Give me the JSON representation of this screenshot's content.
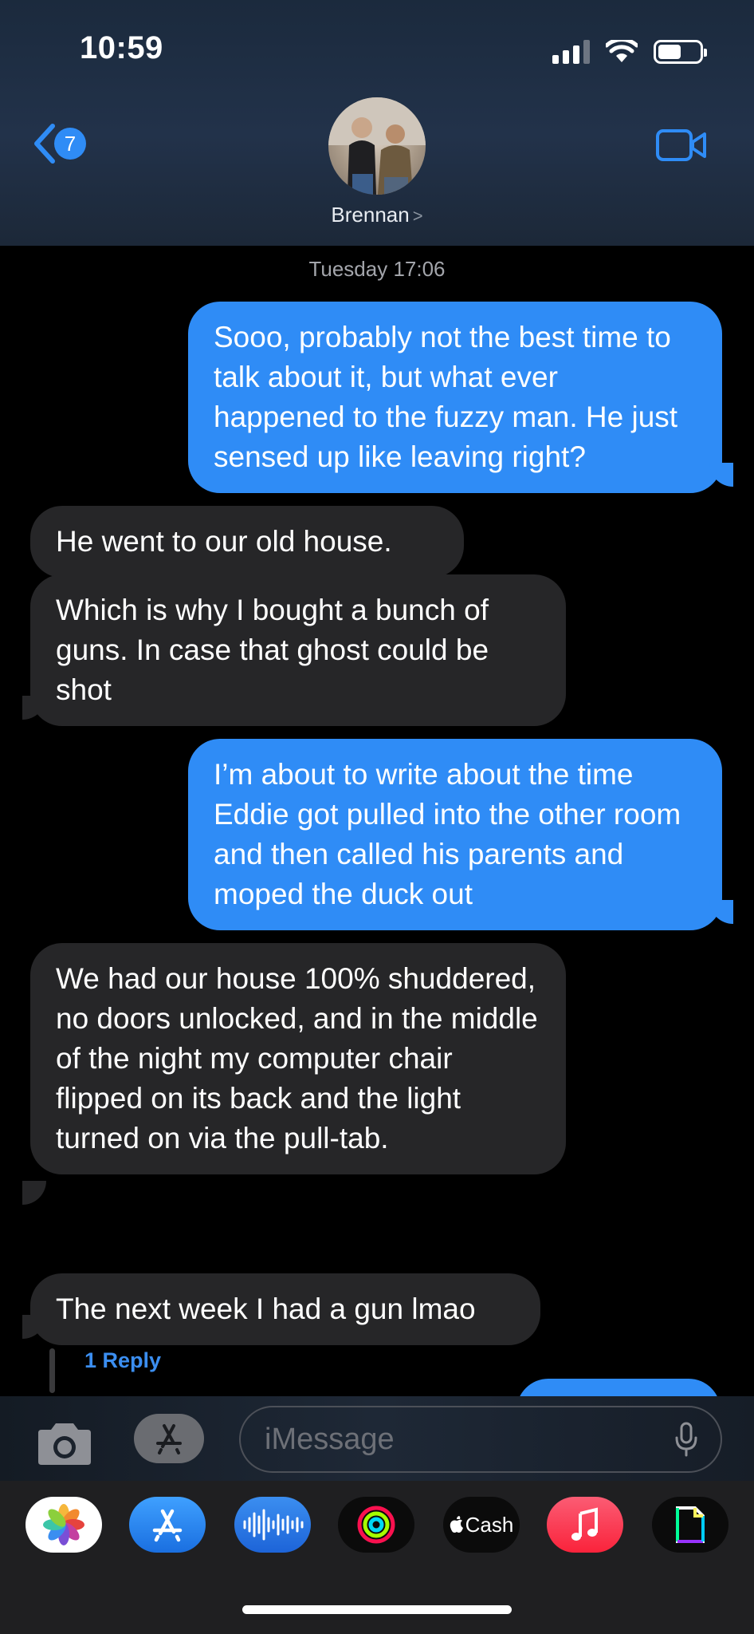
{
  "status": {
    "time": "10:59"
  },
  "header": {
    "back_badge": "7",
    "contact_name": "Brennan",
    "chevron": ">"
  },
  "conversation": {
    "timestamp": "Tuesday 17:06",
    "messages": [
      {
        "dir": "out",
        "text": "Sooo, probably not the best time to talk about it, but what ever happened to the fuzzy man. He just sensed up like leaving right?"
      },
      {
        "dir": "in",
        "text": "He went to our old house."
      },
      {
        "dir": "in",
        "text": "Which is why I bought a bunch of guns. In case that ghost could be shot"
      },
      {
        "dir": "out",
        "text": "I’m about to write about the time Eddie got pulled into the other room and then called his parents and moped the duck out"
      },
      {
        "dir": "in",
        "text": "We had our house 100% shuddered, no doors unlocked, and in the middle of the night my computer chair flipped on its back and the light turned on via the pull-tab."
      },
      {
        "dir": "in",
        "text": "The next week I had a gun lmao"
      }
    ],
    "reply_link": "1 Reply"
  },
  "composer": {
    "placeholder": "iMessage"
  },
  "app_tray": [
    {
      "name": "photos",
      "icon": "photos-icon"
    },
    {
      "name": "app-store",
      "icon": "app-store-icon"
    },
    {
      "name": "audio-message",
      "icon": "waveform-icon"
    },
    {
      "name": "activity",
      "icon": "activity-rings-icon"
    },
    {
      "name": "cash",
      "icon": "cash-icon",
      "label": "Cash"
    },
    {
      "name": "music",
      "icon": "music-note-icon"
    },
    {
      "name": "gif",
      "icon": "gif-icon"
    }
  ],
  "colors": {
    "outgoing_bubble": "#2f8cf6",
    "incoming_bubble": "#262628",
    "accent": "#3b8ef0"
  }
}
